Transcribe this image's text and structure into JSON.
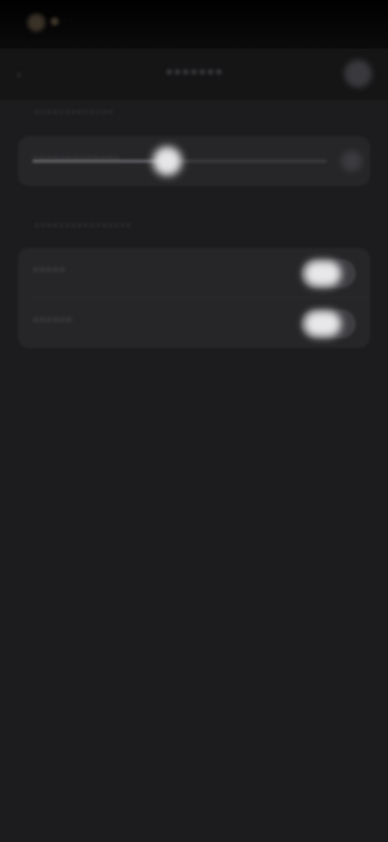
{
  "status_bar": {
    "indicator_icon": "recording-dot-icon",
    "text": "● · ·"
  },
  "nav": {
    "back_icon": "chevron-left-icon",
    "back_glyph": "‹",
    "title": "•••••••",
    "action_icon": "more-icon"
  },
  "section_1": {
    "header": "•••••••••••••",
    "slider": {
      "label": "•••••••••••••",
      "value_fraction": 0.46,
      "end_icon": "brightness-icon"
    }
  },
  "section_2": {
    "header": "••••••••••••••••",
    "rows": [
      {
        "label": "•••••",
        "toggle_on": false
      },
      {
        "label": "••••••",
        "toggle_on": false
      }
    ]
  },
  "colors": {
    "background": "#1c1c1e",
    "card": "#262628",
    "accent": "#e6e6e8"
  }
}
